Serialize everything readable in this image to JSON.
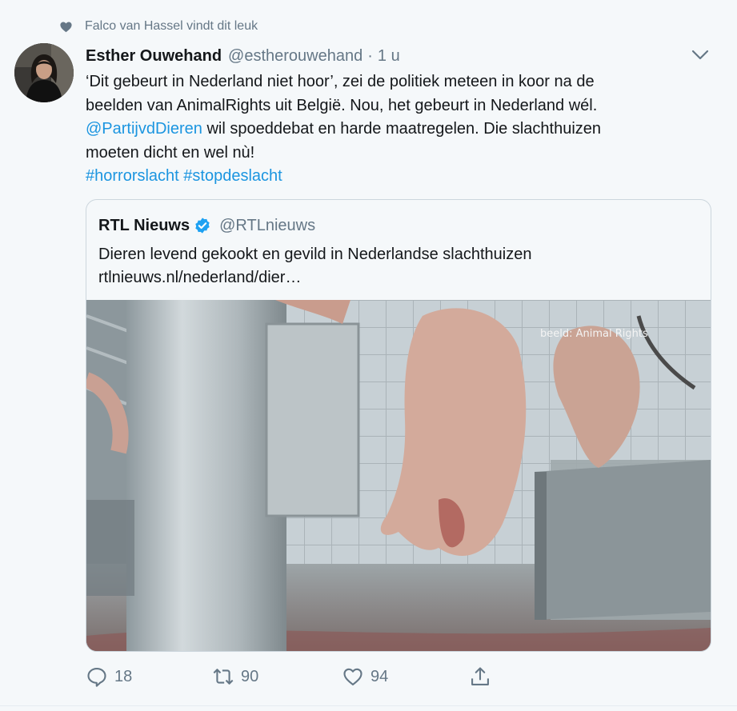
{
  "social_context": {
    "icon": "heart-icon",
    "text": "Falco van Hassel vindt dit leuk"
  },
  "tweet": {
    "author_name": "Esther Ouwehand",
    "author_handle": "@estherouwehand",
    "separator": "·",
    "time": "1 u",
    "text": {
      "line1": "‘Dit gebeurt in Nederland niet hoor’, zei de politiek meteen in koor na de",
      "line2": "beelden van AnimalRights uit België. Nou, het gebeurt in Nederland wél.",
      "mention": "@PartijvdDieren",
      "line3_rest": " wil spoeddebat en harde maatregelen. Die slachthuizen",
      "line4": "moeten dicht en wel nù!",
      "hashtag1": "#horrorslacht",
      "hashtag2": "#stopdeslacht"
    },
    "quoted": {
      "name": "RTL Nieuws",
      "handle": "@RTLnieuws",
      "text": "Dieren levend gekookt en gevild in Nederlandse slachthuizen",
      "link": "rtlnieuws.nl/nederland/dier…",
      "media_watermark": "beeld: Animal Rights"
    },
    "actions": {
      "replies": "18",
      "retweets": "90",
      "likes": "94"
    }
  },
  "colors": {
    "background": "#f5f8fa",
    "link": "#1b95e0",
    "secondary_text": "#657786",
    "verified": "#1da1f2",
    "border": "#ccd6dd"
  }
}
